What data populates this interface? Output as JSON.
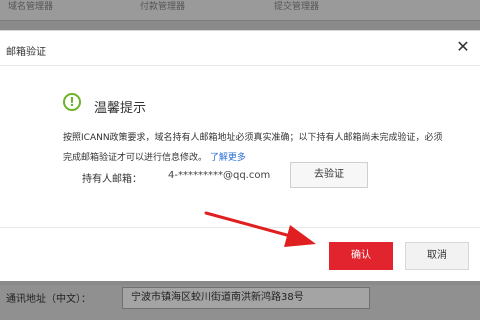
{
  "background": {
    "tabs": [
      "域名管理器",
      "付款管理器",
      "提交管理器"
    ],
    "bottom_label": "通讯地址（中文）：",
    "bottom_value": "宁波市镇海区蛟川街道南洪新鸿路38号"
  },
  "dialog": {
    "title": "邮箱验证",
    "tip_title": "温馨提示",
    "tip_text": "按照ICANN政策要求，域名持有人邮箱地址必须真实准确；以下持有人邮箱尚未完成验证，必须完成邮箱验证才可以进行信息修改。",
    "learn_more": "了解更多",
    "email_label": "持有人邮箱：",
    "email_value": "4-*********@qq.com",
    "verify_button": "去验证",
    "confirm_button": "确认",
    "cancel_button": "取消"
  },
  "colors": {
    "accent_red": "#e1242e",
    "tip_green": "#6cb22a",
    "link_blue": "#2b6fd8",
    "arrow_red": "#e02020"
  },
  "icons": {
    "close": "close-icon",
    "tip": "exclamation-circle-icon",
    "arrow": "red-arrow-annotation"
  }
}
